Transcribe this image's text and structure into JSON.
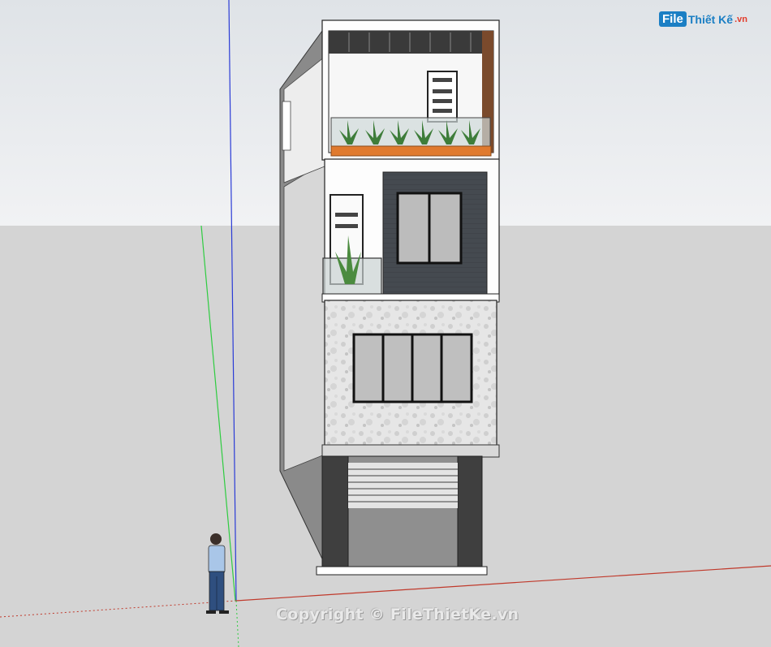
{
  "watermark": {
    "logo_box": "File",
    "logo_text": "Thiết Kế",
    "logo_tld": ".vn",
    "copyright": "Copyright © FileThietKe.vn"
  },
  "scene": {
    "sky_color": "#e9ecef",
    "ground_color": "#d4d4d4",
    "axis_colors": {
      "red": "#c0392b",
      "green": "#2ecc40",
      "blue": "#2a3bd6"
    },
    "figure": "standing-person"
  }
}
